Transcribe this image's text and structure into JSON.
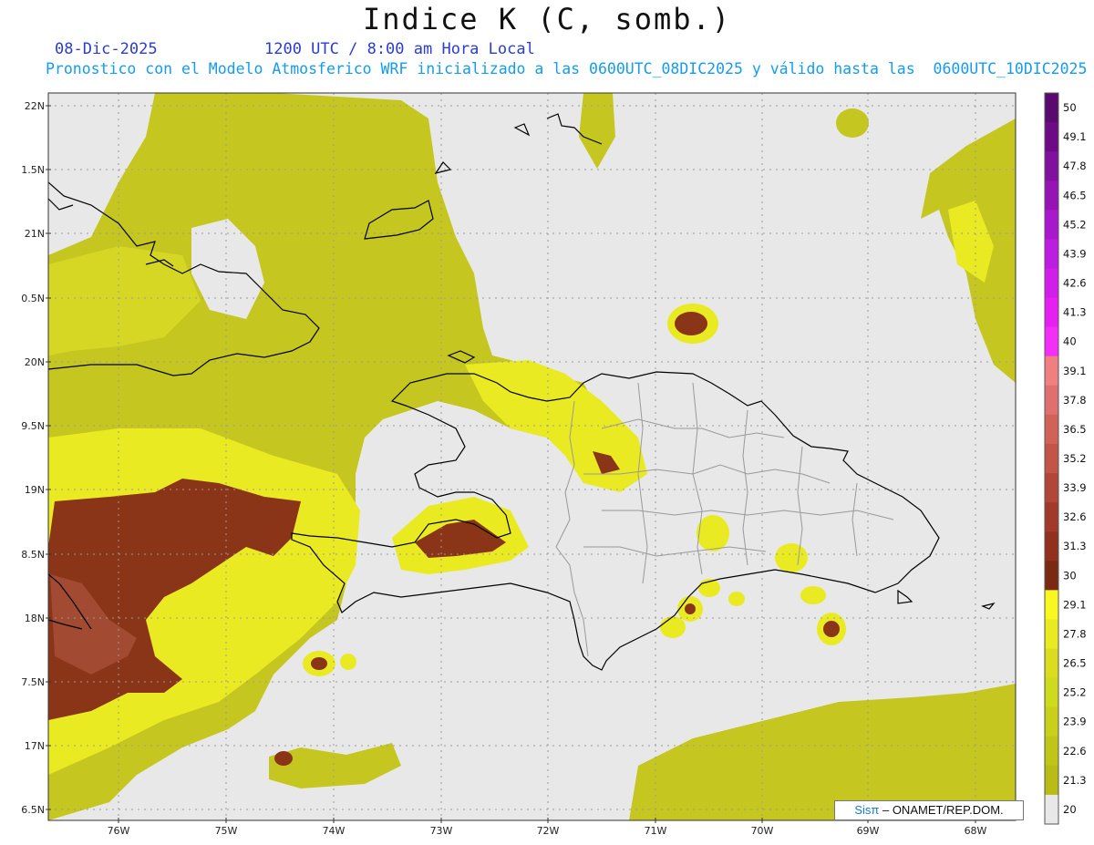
{
  "title": "Indice K (C, somb.)",
  "date": "08-Dic-2025",
  "time": "1200 UTC / 8:00 am Hora Local",
  "description": "Pronostico con el Modelo Atmosferico WRF inicializado a las 0600UTC_08DIC2025 y válido hasta las  0600UTC_10DIC2025",
  "lat_labels": [
    "22N",
    "1.5N",
    "21N",
    "0.5N",
    "20N",
    "9.5N",
    "19N",
    "8.5N",
    "18N",
    "7.5N",
    "17N",
    "6.5N"
  ],
  "lon_labels": [
    "76W",
    "75W",
    "74W",
    "73W",
    "72W",
    "71W",
    "70W",
    "69W",
    "68W"
  ],
  "colorbar": {
    "labels": [
      "50",
      "49.1",
      "47.8",
      "46.5",
      "45.2",
      "43.9",
      "42.6",
      "41.3",
      "40",
      "39.1",
      "37.8",
      "36.5",
      "35.2",
      "33.9",
      "32.6",
      "31.3",
      "30",
      "29.1",
      "27.8",
      "26.5",
      "25.2",
      "23.9",
      "22.6",
      "21.3",
      "20"
    ],
    "colors": [
      "#5a0a6e",
      "#6e0a86",
      "#82109e",
      "#9614b6",
      "#aa18ce",
      "#be1ce0",
      "#d21eea",
      "#e620f2",
      "#f42ef8",
      "#f08080",
      "#e07070",
      "#d06258",
      "#c25448",
      "#b24638",
      "#a23a2a",
      "#92301e",
      "#7a2a12",
      "#f8f820",
      "#eaea20",
      "#dcdc1e",
      "#ceda1c",
      "#c8d01a",
      "#c0c618",
      "#b8bc14",
      "#e8e8e8"
    ]
  },
  "credit": {
    "brand": "Sisπ",
    "text": " – ONAMET/REP.DOM."
  },
  "colors": {
    "background": "#e8e8e8",
    "yellow_low": "#c6c620",
    "yellow_high": "#f0f020",
    "brown": "#8a3418"
  }
}
